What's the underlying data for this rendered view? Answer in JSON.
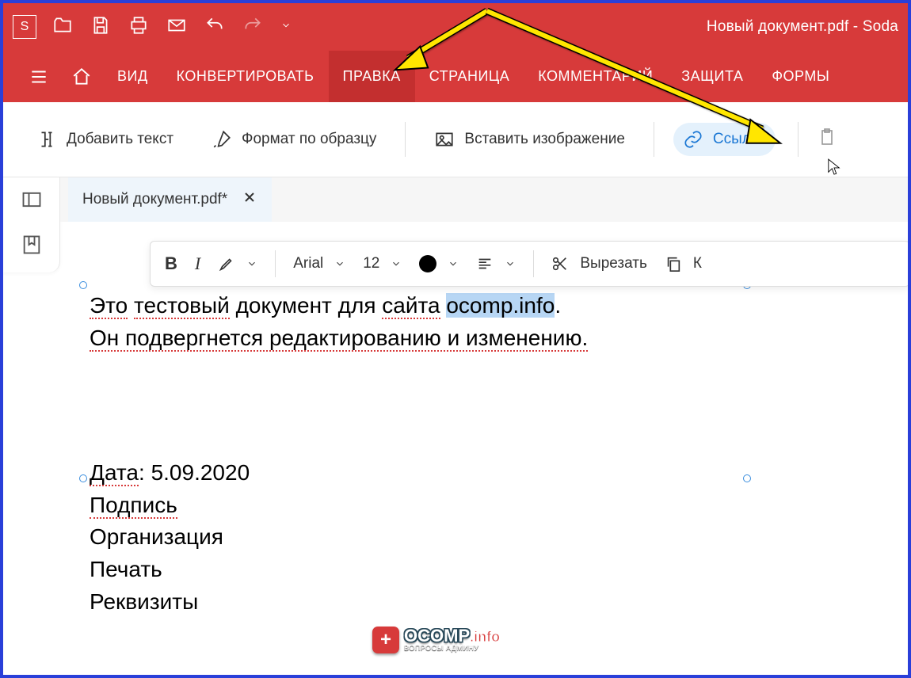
{
  "app": {
    "logo_letter": "S",
    "title": "Новый документ.pdf   -   Soda"
  },
  "menu": {
    "items": [
      "ВИД",
      "КОНВЕРТИРОВАТЬ",
      "ПРАВКА",
      "СТРАНИЦА",
      "КОММЕНТАРИЙ",
      "ЗАЩИТА",
      "ФОРМЫ"
    ],
    "active_index": 2
  },
  "toolbar": {
    "add_text": "Добавить текст",
    "format_painter": "Формат по образцу",
    "insert_image": "Вставить изображение",
    "link": "Ссылка"
  },
  "doctab": {
    "label": "Новый документ.pdf*"
  },
  "fmtbar": {
    "font": "Arial",
    "size": "12",
    "cut": "Вырезать",
    "copy_initial": "К"
  },
  "document": {
    "line1_a": "Это",
    "line1_b": "тестовый",
    "line1_c": "документ для",
    "line1_d": "сайта",
    "line1_sel": "ocomp.info",
    "line1_e": ".",
    "line2": "Он подвергнется редактированию и изменению.",
    "date_label": "Дата",
    "date_value": "5.09.2020",
    "signature": "Подпись",
    "organization": "Организация",
    "stamp": "Печать",
    "requisites": "Реквизиты"
  },
  "watermark": {
    "main": "OCOMP",
    "suffix": ".info",
    "sub": "ВОПРОСЫ АДМИНУ"
  },
  "colors": {
    "brand": "#d73a3a",
    "accent": "#1a77d4",
    "selection": "#b7d6f4"
  }
}
